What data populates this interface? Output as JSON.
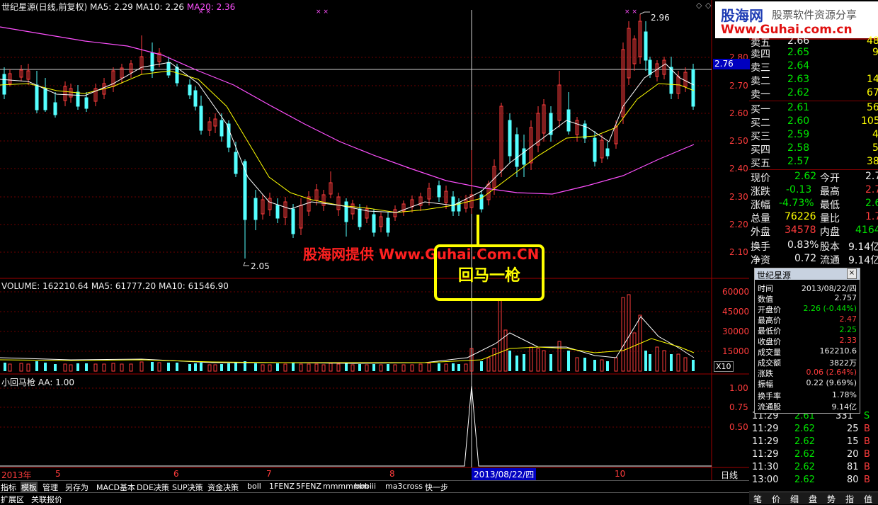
{
  "header": {
    "stock": "世纪星源(日线,前复权)",
    "ma5": "MA5: 2.29",
    "ma10": "MA10: 2.26",
    "ma20": "MA20: 2.36",
    "marks": "× ×"
  },
  "price_axis": [
    "2.80",
    "2.70",
    "2.60",
    "2.50",
    "2.40",
    "2.30",
    "2.20",
    "2.10"
  ],
  "price_tag": "2.76",
  "annotations": {
    "high": "2.96",
    "low": "2.05"
  },
  "watermark": "股海网提供 Www.Guhai.Com.CN",
  "callout": "回马一枪",
  "logo": {
    "top": "股海网",
    "right": "股票软件资源分享",
    "url": "Www.Guhai.com.cn"
  },
  "volume": {
    "label": "VOLUME: 162210.64",
    "ma5": "MA5: 61777.20",
    "ma10": "MA10: 61546.90",
    "axis": [
      "60000",
      "45000",
      "30000",
      "15000"
    ],
    "unit": "X10"
  },
  "indicator": {
    "label": "小回马枪",
    "aa": "AA: 1.00",
    "axis": [
      "1.00",
      "0.75",
      "0.50"
    ]
  },
  "date_axis": {
    "year": "2013年",
    "months": [
      "5",
      "6",
      "7",
      "8",
      "10"
    ],
    "cursor": "2013/08/22/四",
    "period": "日线"
  },
  "orderbook": {
    "sell": [
      {
        "label": "卖五",
        "price": "2.66",
        "vol": "48"
      },
      {
        "label": "卖四",
        "price": "2.65",
        "vol": "9"
      },
      {
        "label": "卖三",
        "price": "2.64",
        "vol": ""
      },
      {
        "label": "卖二",
        "price": "2.63",
        "vol": "14"
      },
      {
        "label": "卖一",
        "price": "2.62",
        "vol": "67"
      }
    ],
    "buy": [
      {
        "label": "买一",
        "price": "2.61",
        "vol": "56"
      },
      {
        "label": "买二",
        "price": "2.60",
        "vol": "105"
      },
      {
        "label": "买三",
        "price": "2.59",
        "vol": "4"
      },
      {
        "label": "买四",
        "price": "2.58",
        "vol": "5"
      },
      {
        "label": "买五",
        "price": "2.57",
        "vol": "38"
      }
    ]
  },
  "quote": [
    {
      "k1": "现价",
      "v1": "2.62",
      "k2": "今开",
      "v2": "2.7"
    },
    {
      "k1": "涨跌",
      "v1": "-0.13",
      "k2": "最高",
      "v2": "2.7"
    },
    {
      "k1": "涨幅",
      "v1": "-4.73%",
      "k2": "最低",
      "v2": "2.6"
    },
    {
      "k1": "总量",
      "v1": "76226",
      "k2": "量比",
      "v2": "1.7"
    },
    {
      "k1": "外盘",
      "v1": "34578",
      "k2": "内盘",
      "v2": "4164"
    },
    {
      "k1": "换手",
      "v1": "0.83%",
      "k2": "股本",
      "v2": "9.14亿"
    },
    {
      "k1": "净资",
      "v1": "0.72",
      "k2": "流通",
      "v2": "9.14亿"
    }
  ],
  "popup": {
    "title": "世纪星源",
    "close": "×",
    "rows": [
      {
        "k": "时间",
        "v": "2013/08/22/四"
      },
      {
        "k": "数值",
        "v": "2.757"
      },
      {
        "k": "开盘价",
        "v": "2.26 (-0.44%)"
      },
      {
        "k": "最高价",
        "v": "2.47"
      },
      {
        "k": "最低价",
        "v": "2.25"
      },
      {
        "k": "收盘价",
        "v": "2.33"
      },
      {
        "k": "成交量",
        "v": "162210.6"
      },
      {
        "k": "成交额",
        "v": "3822万"
      },
      {
        "k": "涨跌",
        "v": "0.06 (2.64%)"
      },
      {
        "k": "振幅",
        "v": "0.22 (9.69%)"
      },
      {
        "k": "换手率",
        "v": "1.78%"
      },
      {
        "k": "流通股",
        "v": "9.14亿"
      }
    ]
  },
  "ticks": [
    {
      "time": "11:29",
      "price": "2.61",
      "vol": "331",
      "side": "S"
    },
    {
      "time": "11:29",
      "price": "2.62",
      "vol": "25",
      "side": "B"
    },
    {
      "time": "11:29",
      "price": "2.62",
      "vol": "15",
      "side": "B"
    },
    {
      "time": "11:29",
      "price": "2.62",
      "vol": "20",
      "side": "B"
    },
    {
      "time": "11:30",
      "price": "2.62",
      "vol": "81",
      "side": "B"
    },
    {
      "time": "13:00",
      "price": "2.62",
      "vol": "80",
      "side": "B"
    }
  ],
  "tabs": [
    "指标",
    "模板",
    "管理",
    "另存为",
    "MACD基本",
    "DDE决策",
    "SUP决策",
    "资金决策",
    "boll",
    "1FENZ",
    "5FENZ",
    "mmmmmm",
    "bbbiii",
    "ma3cross",
    "快一步"
  ],
  "bottom_tabs": [
    "扩展区",
    "关联报价"
  ],
  "right_tabs": [
    "笔",
    "价",
    "细",
    "盘",
    "势",
    "指",
    "值"
  ],
  "nav": {
    "plus": "+",
    "minus": "-",
    "diamond": "◇"
  },
  "colors": {
    "up": "#ff3c3c",
    "down": "#54ffff",
    "ma5": "#ffffff",
    "ma10": "#ffff00",
    "ma20": "#ff50ff",
    "grid": "#800000",
    "bg": "#000000"
  }
}
